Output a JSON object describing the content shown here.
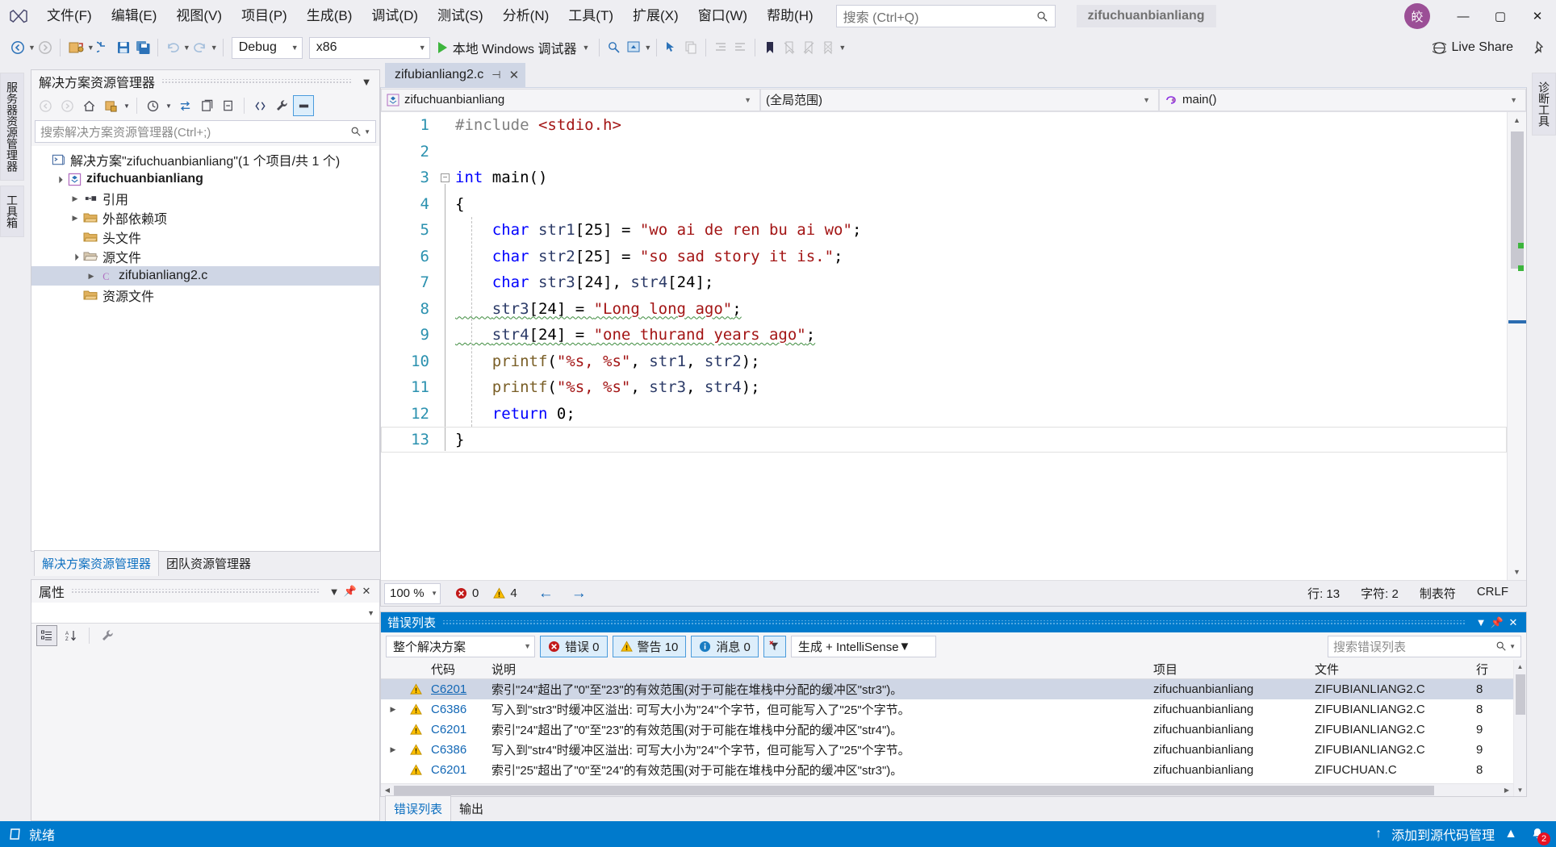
{
  "titlebar": {
    "logo_icon": "visual-studio-logo",
    "menus": [
      "文件(F)",
      "编辑(E)",
      "视图(V)",
      "项目(P)",
      "生成(B)",
      "调试(D)",
      "测试(S)",
      "分析(N)",
      "工具(T)",
      "扩展(X)",
      "窗口(W)",
      "帮助(H)"
    ],
    "search_placeholder": "搜索 (Ctrl+Q)",
    "search_icon": "search-icon",
    "solution_name": "zifuchuanbianliang",
    "account_initials": "皎",
    "minimize": "—",
    "maximize": "▢",
    "close": "✕"
  },
  "toolbar": {
    "configuration": "Debug",
    "platform": "x86",
    "debug_target": "本地 Windows 调试器",
    "live_share": "Live Share"
  },
  "vtabs_left": [
    "服务器资源管理器",
    "工具箱"
  ],
  "vtabs_right": [
    "诊断工具"
  ],
  "solution_explorer": {
    "title": "解决方案资源管理器",
    "search_placeholder": "搜索解决方案资源管理器(Ctrl+;)",
    "tree": [
      {
        "label": "解决方案\"zifuchuanbianliang\"(1 个项目/共 1 个)",
        "indent": 0,
        "twisty": "",
        "icon": "solution-icon",
        "bold": false,
        "selected": false
      },
      {
        "label": "zifuchuanbianliang",
        "indent": 1,
        "twisty": "▲",
        "icon": "project-icon",
        "bold": true,
        "selected": false
      },
      {
        "label": "引用",
        "indent": 2,
        "twisty": "▶",
        "icon": "references-icon",
        "bold": false,
        "selected": false
      },
      {
        "label": "外部依赖项",
        "indent": 2,
        "twisty": "▶",
        "icon": "folder-icon",
        "bold": false,
        "selected": false
      },
      {
        "label": "头文件",
        "indent": 2,
        "twisty": "",
        "icon": "folder-icon",
        "bold": false,
        "selected": false
      },
      {
        "label": "源文件",
        "indent": 2,
        "twisty": "▲",
        "icon": "folder-open-icon",
        "bold": false,
        "selected": false
      },
      {
        "label": "zifubianliang2.c",
        "indent": 3,
        "twisty": "▶",
        "icon": "c-file-icon",
        "bold": false,
        "selected": true
      },
      {
        "label": "资源文件",
        "indent": 2,
        "twisty": "",
        "icon": "folder-icon",
        "bold": false,
        "selected": false
      }
    ],
    "tabs": [
      {
        "label": "解决方案资源管理器",
        "selected": true
      },
      {
        "label": "团队资源管理器",
        "selected": false
      }
    ]
  },
  "properties": {
    "title": "属性"
  },
  "editor": {
    "tab_name": "zifubianliang2.c",
    "nav_project": "zifuchuanbianliang",
    "nav_scope": "(全局范围)",
    "nav_member": "main()",
    "lines": [
      {
        "n": 1,
        "tokens": [
          {
            "t": "#include ",
            "c": "pp"
          },
          {
            "t": "<stdio.h>",
            "c": "inc"
          }
        ]
      },
      {
        "n": 2,
        "tokens": []
      },
      {
        "n": 3,
        "tokens": [
          {
            "t": "int",
            "c": "kw"
          },
          {
            "t": " main()",
            "c": "num"
          }
        ]
      },
      {
        "n": 4,
        "tokens": [
          {
            "t": "{",
            "c": "num"
          }
        ]
      },
      {
        "n": 5,
        "tokens": [
          {
            "t": "    ",
            "c": "num"
          },
          {
            "t": "char",
            "c": "kw"
          },
          {
            "t": " ",
            "c": "num"
          },
          {
            "t": "str1",
            "c": "id"
          },
          {
            "t": "[25] = ",
            "c": "num"
          },
          {
            "t": "\"wo ai de ren bu ai wo\"",
            "c": "str"
          },
          {
            "t": ";",
            "c": "num"
          }
        ]
      },
      {
        "n": 6,
        "tokens": [
          {
            "t": "    ",
            "c": "num"
          },
          {
            "t": "char",
            "c": "kw"
          },
          {
            "t": " ",
            "c": "num"
          },
          {
            "t": "str2",
            "c": "id"
          },
          {
            "t": "[25] = ",
            "c": "num"
          },
          {
            "t": "\"so sad story it is.\"",
            "c": "str"
          },
          {
            "t": ";",
            "c": "num"
          }
        ]
      },
      {
        "n": 7,
        "tokens": [
          {
            "t": "    ",
            "c": "num"
          },
          {
            "t": "char",
            "c": "kw"
          },
          {
            "t": " ",
            "c": "num"
          },
          {
            "t": "str3",
            "c": "id"
          },
          {
            "t": "[24], ",
            "c": "num"
          },
          {
            "t": "str4",
            "c": "id"
          },
          {
            "t": "[24];",
            "c": "num"
          }
        ]
      },
      {
        "n": 8,
        "squiggle": true,
        "tokens": [
          {
            "t": "    ",
            "c": "num"
          },
          {
            "t": "str3",
            "c": "id"
          },
          {
            "t": "[24] = ",
            "c": "num"
          },
          {
            "t": "\"Long long ago\"",
            "c": "str"
          },
          {
            "t": ";",
            "c": "num"
          }
        ]
      },
      {
        "n": 9,
        "squiggle": true,
        "tokens": [
          {
            "t": "    ",
            "c": "num"
          },
          {
            "t": "str4",
            "c": "id"
          },
          {
            "t": "[24] = ",
            "c": "num"
          },
          {
            "t": "\"one thurand years ago\"",
            "c": "str"
          },
          {
            "t": ";",
            "c": "num"
          }
        ]
      },
      {
        "n": 10,
        "tokens": [
          {
            "t": "    ",
            "c": "num"
          },
          {
            "t": "printf",
            "c": "fn"
          },
          {
            "t": "(",
            "c": "num"
          },
          {
            "t": "\"%s, %s\"",
            "c": "str"
          },
          {
            "t": ", ",
            "c": "num"
          },
          {
            "t": "str1",
            "c": "id"
          },
          {
            "t": ", ",
            "c": "num"
          },
          {
            "t": "str2",
            "c": "id"
          },
          {
            "t": ");",
            "c": "num"
          }
        ]
      },
      {
        "n": 11,
        "tokens": [
          {
            "t": "    ",
            "c": "num"
          },
          {
            "t": "printf",
            "c": "fn"
          },
          {
            "t": "(",
            "c": "num"
          },
          {
            "t": "\"%s, %s\"",
            "c": "str"
          },
          {
            "t": ", ",
            "c": "num"
          },
          {
            "t": "str3",
            "c": "id"
          },
          {
            "t": ", ",
            "c": "num"
          },
          {
            "t": "str4",
            "c": "id"
          },
          {
            "t": ");",
            "c": "num"
          }
        ]
      },
      {
        "n": 12,
        "tokens": [
          {
            "t": "    ",
            "c": "num"
          },
          {
            "t": "return",
            "c": "kw"
          },
          {
            "t": " ",
            "c": "num"
          },
          {
            "t": "0",
            "c": "num"
          },
          {
            "t": ";",
            "c": "num"
          }
        ]
      },
      {
        "n": 13,
        "tokens": [
          {
            "t": "}",
            "c": "num"
          }
        ]
      }
    ],
    "status": {
      "zoom": "100 %",
      "error_count": "0",
      "warning_count": "4",
      "line": "行: 13",
      "column": "字符: 2",
      "tabs_mode": "制表符",
      "eol": "CRLF"
    }
  },
  "error_list": {
    "title": "错误列表",
    "scope": "整个解决方案",
    "errors_label": "错误 0",
    "warnings_label": "警告 10",
    "messages_label": "消息 0",
    "filter_icon": "clear-filter-icon",
    "build_source": "生成 + IntelliSense",
    "search_placeholder": "搜索错误列表",
    "columns": [
      "",
      "",
      "代码",
      "说明",
      "项目",
      "文件",
      "行"
    ],
    "rows": [
      {
        "twisty": "",
        "severity": "warning",
        "code": "C6201",
        "description": "索引\"24\"超出了\"0\"至\"23\"的有效范围(对于可能在堆栈中分配的缓冲区\"str3\")。",
        "project": "zifuchuanbianliang",
        "file": "ZIFUBIANLIANG2.C",
        "line": "8",
        "selected": true
      },
      {
        "twisty": "▶",
        "severity": "warning",
        "code": "C6386",
        "description": "写入到\"str3\"时缓冲区溢出: 可写大小为\"24\"个字节，但可能写入了\"25\"个字节。",
        "project": "zifuchuanbianliang",
        "file": "ZIFUBIANLIANG2.C",
        "line": "8",
        "selected": false
      },
      {
        "twisty": "",
        "severity": "warning",
        "code": "C6201",
        "description": "索引\"24\"超出了\"0\"至\"23\"的有效范围(对于可能在堆栈中分配的缓冲区\"str4\")。",
        "project": "zifuchuanbianliang",
        "file": "ZIFUBIANLIANG2.C",
        "line": "9",
        "selected": false
      },
      {
        "twisty": "▶",
        "severity": "warning",
        "code": "C6386",
        "description": "写入到\"str4\"时缓冲区溢出: 可写大小为\"24\"个字节，但可能写入了\"25\"个字节。",
        "project": "zifuchuanbianliang",
        "file": "ZIFUBIANLIANG2.C",
        "line": "9",
        "selected": false
      },
      {
        "twisty": "",
        "severity": "warning",
        "code": "C6201",
        "description": "索引\"25\"超出了\"0\"至\"24\"的有效范围(对于可能在堆栈中分配的缓冲区\"str3\")。",
        "project": "zifuchuanbianliang",
        "file": "ZIFUCHUAN.C",
        "line": "8",
        "selected": false
      }
    ],
    "tabs": [
      {
        "label": "错误列表",
        "selected": true
      },
      {
        "label": "输出",
        "selected": false
      }
    ]
  },
  "statusbar": {
    "state_icon": "ready-icon",
    "state": "就绪",
    "source_control": "添加到源代码管理",
    "bell_icon": "bell-icon",
    "bell_count": "2"
  },
  "colors": {
    "accent": "#007acc",
    "selection": "#cfd6e5",
    "keyword": "#0000ff",
    "string": "#a31515",
    "linenum": "#2b91af",
    "warning": "#ffc000",
    "error": "#e81123"
  }
}
